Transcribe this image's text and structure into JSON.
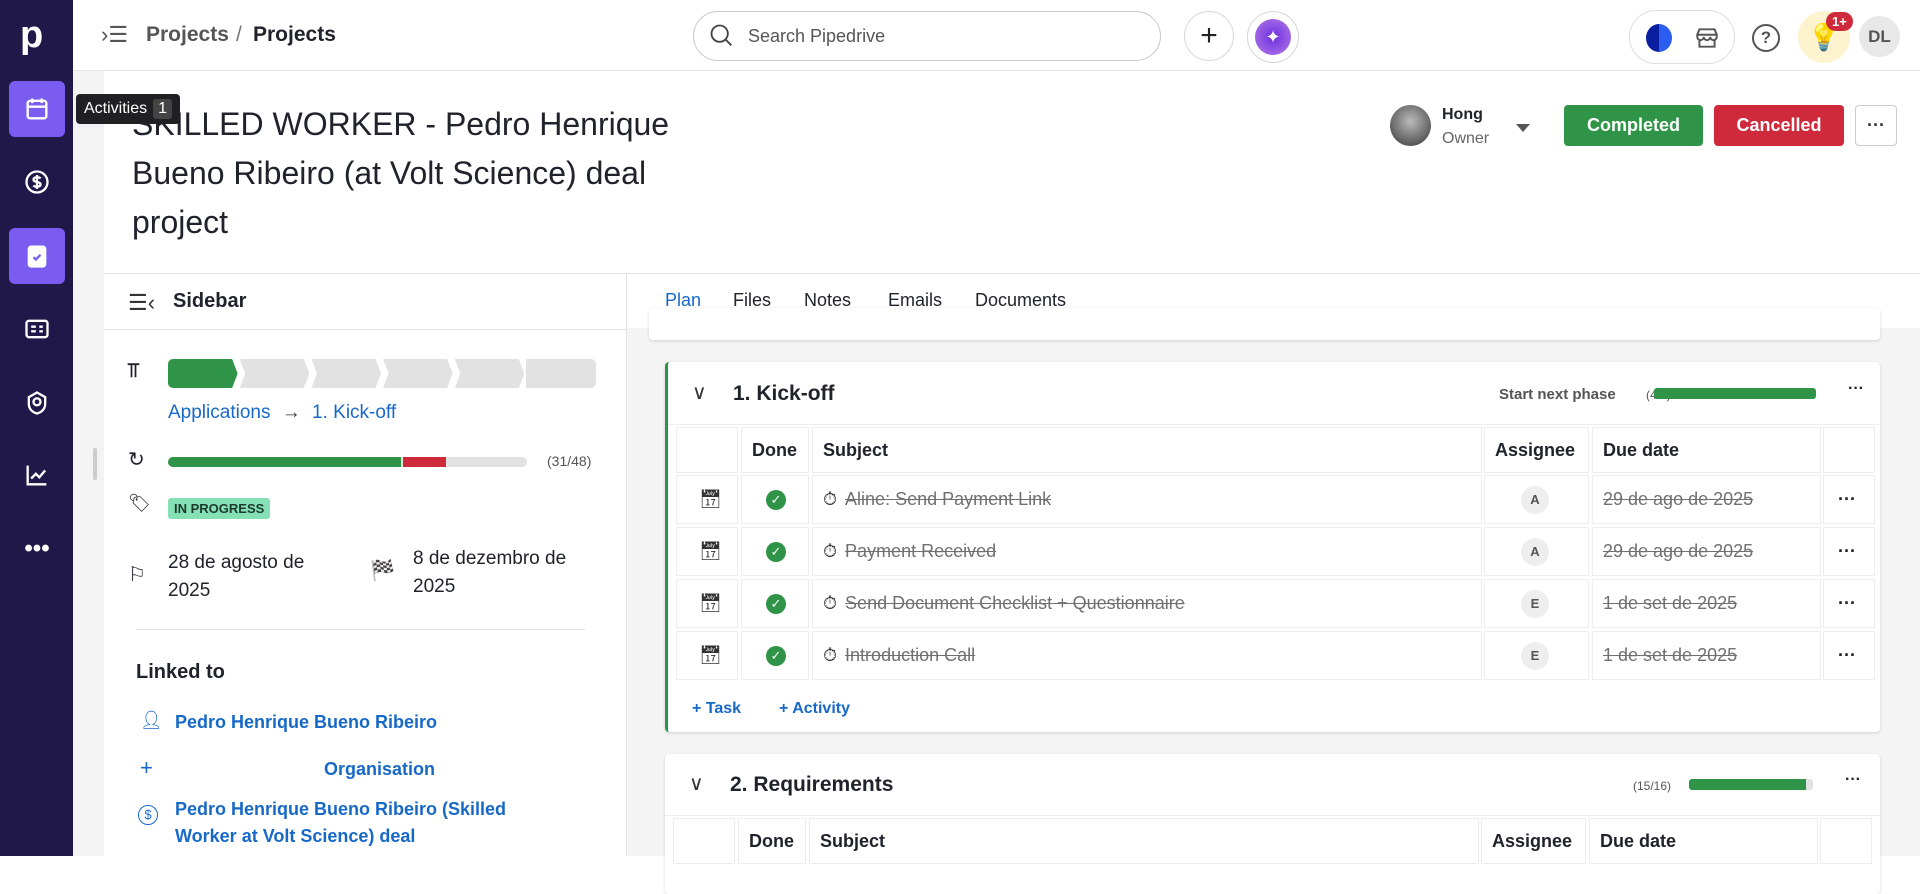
{
  "nav": {
    "logo": "p",
    "items": [
      {
        "icon": "activities-icon",
        "active": true
      },
      {
        "icon": "dollar-icon"
      },
      {
        "icon": "projects-icon",
        "active": true
      },
      {
        "icon": "contacts-icon"
      },
      {
        "icon": "leads-icon"
      },
      {
        "icon": "insights-icon"
      },
      {
        "icon": "more-icon"
      }
    ],
    "tooltip": {
      "label": "Activities",
      "count": "1"
    }
  },
  "header": {
    "breadcrumb_parent": "Projects",
    "separator": "/",
    "breadcrumb_current": "Projects",
    "search_placeholder": "Search Pipedrive",
    "notification_badge": "1+",
    "user_initials": "DL"
  },
  "project": {
    "title": "SKILLED WORKER - Pedro Henrique Bueno Ribeiro (at Volt Science) deal project",
    "owner_name": "Hong",
    "owner_role": "Owner",
    "completed_label": "Completed",
    "cancelled_label": "Cancelled",
    "more_label": "···"
  },
  "sidebar": {
    "title": "Sidebar",
    "pipeline": "Applications",
    "arrow": "→",
    "phase": "1. Kick-off",
    "stages_total": 6,
    "stages_done": 1,
    "progress": {
      "text": "(31/48)",
      "done_pct": 65,
      "overdue_pct": 12
    },
    "status": "IN PROGRESS",
    "start_date": "28 de agosto de 2025",
    "end_date": "8 de dezembro de 2025",
    "linked_title": "Linked to",
    "person": "Pedro Henrique Bueno Ribeiro",
    "organisation": "Organisation",
    "deal": "Pedro Henrique Bueno Ribeiro (Skilled Worker at Volt Science) deal"
  },
  "tabs": [
    "Plan",
    "Files",
    "Notes",
    "Emails",
    "Documents"
  ],
  "phases": [
    {
      "title": "1. Kick-off",
      "start_next": "Start next phase",
      "count": "(4/4)",
      "pct": 100,
      "columns": [
        "Done",
        "Subject",
        "Assignee",
        "Due date"
      ],
      "rows": [
        {
          "subject": "Aline: Send Payment Link",
          "assignee": "A",
          "due": "29 de ago de 2025"
        },
        {
          "subject": "Payment Received",
          "assignee": "A",
          "due": "29 de ago de 2025"
        },
        {
          "subject": "Send Document Checklist + Questionnaire",
          "assignee": "E",
          "due": "1 de set de 2025"
        },
        {
          "subject": "Introduction Call",
          "assignee": "E",
          "due": "1 de set de 2025"
        }
      ],
      "add_task": "Task",
      "add_activity": "Activity"
    },
    {
      "title": "2. Requirements",
      "count": "(15/16)",
      "pct": 94,
      "columns": [
        "Done",
        "Subject",
        "Assignee",
        "Due date"
      ]
    }
  ],
  "colors": {
    "nav": "#21184a",
    "accent": "#7a5cf0",
    "green": "#2f9447",
    "red": "#cf2a3c",
    "link": "#1769c8"
  }
}
